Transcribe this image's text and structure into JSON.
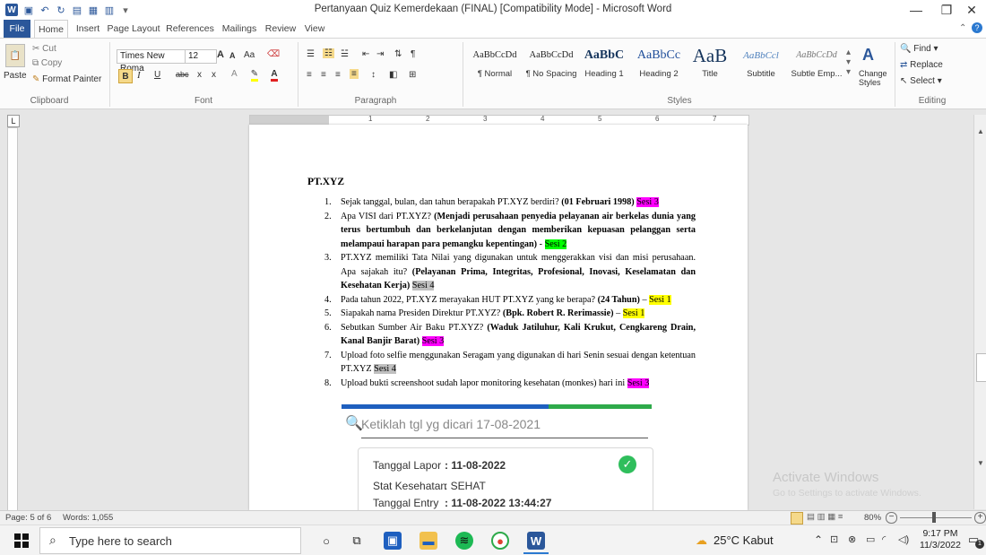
{
  "window": {
    "title": "Pertanyaan Quiz Kemerdekaan (FINAL) [Compatibility Mode] - Microsoft Word",
    "app_logo": "W",
    "minimize_glyph": "—",
    "restore_glyph": "❐",
    "close_glyph": "✕"
  },
  "tabs": [
    "File",
    "Home",
    "Insert",
    "Page Layout",
    "References",
    "Mailings",
    "Review",
    "View"
  ],
  "ribbon": {
    "clipboard": {
      "paste": "Paste",
      "cut": "Cut",
      "copy": "Copy",
      "format_painter": "Format Painter",
      "label": "Clipboard"
    },
    "font": {
      "name": "Times New Roma",
      "size": "12",
      "grow": "A",
      "shrink": "A",
      "change_case": "Aa",
      "bold": "B",
      "italic": "I",
      "underline": "U",
      "strike": "abc",
      "subscript": "x",
      "superscript": "x",
      "label": "Font"
    },
    "paragraph": {
      "label": "Paragraph",
      "pilcrow": "¶"
    },
    "styles": {
      "label": "Styles",
      "items": [
        {
          "sample": "AaBbCcDd",
          "name": "¶ Normal"
        },
        {
          "sample": "AaBbCcDd",
          "name": "¶ No Spacing"
        },
        {
          "sample": "AaBbC",
          "name": "Heading 1"
        },
        {
          "sample": "AaBbCc",
          "name": "Heading 2"
        },
        {
          "sample": "AaB",
          "name": "Title"
        },
        {
          "sample": "AaBbCcl",
          "name": "Subtitle"
        },
        {
          "sample": "AaBbCcDd",
          "name": "Subtle Emp..."
        }
      ],
      "change_styles": "Change Styles"
    },
    "editing": {
      "find": "Find",
      "replace": "Replace",
      "select": "Select",
      "label": "Editing"
    }
  },
  "ruler": {
    "numbers": [
      "1",
      "2",
      "3",
      "4",
      "5",
      "6",
      "7"
    ],
    "corner": "L"
  },
  "document": {
    "heading": "PT.XYZ",
    "questions": [
      {
        "num": "1.",
        "parts": [
          {
            "t": "Sejak tanggal, bulan, dan tahun berapakah PT.XYZ berdiri? ",
            "s": ""
          },
          {
            "t": "(01 Februari 1998)",
            "s": "b"
          },
          {
            "t": " ",
            "s": ""
          },
          {
            "t": "Sesi 3",
            "s": "hl-mag"
          }
        ]
      },
      {
        "num": "2.",
        "parts": [
          {
            "t": "Apa VISI dari PT.XYZ? ",
            "s": ""
          },
          {
            "t": "(Menjadi perusahaan penyedia pelayanan air berkelas dunia yang terus bertumbuh dan berkelanjutan dengan memberikan kepuasan pelanggan serta melampaui harapan para pemangku kepentingan)",
            "s": "b"
          },
          {
            "t": " - ",
            "s": ""
          },
          {
            "t": "Sesi 2",
            "s": "hl-grn"
          }
        ]
      },
      {
        "num": "3.",
        "parts": [
          {
            "t": "PT.XYZ memiliki Tata Nilai yang digunakan untuk menggerakkan visi dan misi perusahaan. Apa sajakah itu? ",
            "s": ""
          },
          {
            "t": "(Pelayanan Prima, Integritas, Profesional, Inovasi, Keselamatan dan Kesehatan Kerja)",
            "s": "b"
          },
          {
            "t": " ",
            "s": ""
          },
          {
            "t": "Sesi 4",
            "s": "hl-gry"
          }
        ]
      },
      {
        "num": "4.",
        "parts": [
          {
            "t": "Pada tahun 2022, PT.XYZ merayakan HUT PT.XYZ yang ke berapa? ",
            "s": ""
          },
          {
            "t": "(24 Tahun)",
            "s": "b"
          },
          {
            "t": " – ",
            "s": ""
          },
          {
            "t": "Sesi 1",
            "s": "hl-yel"
          }
        ]
      },
      {
        "num": "5.",
        "parts": [
          {
            "t": "Siapakah nama Presiden Direktur PT.XYZ? ",
            "s": ""
          },
          {
            "t": "(Bpk. Robert R. Rerimassie)",
            "s": "b"
          },
          {
            "t": " – ",
            "s": ""
          },
          {
            "t": "Sesi 1",
            "s": "hl-yel"
          }
        ]
      },
      {
        "num": "6.",
        "parts": [
          {
            "t": "Sebutkan Sumber Air Baku PT.XYZ? ",
            "s": ""
          },
          {
            "t": "(Waduk Jatiluhur, Kali Krukut, Cengkareng Drain, Kanal Banjir Barat)",
            "s": "b"
          },
          {
            "t": " ",
            "s": ""
          },
          {
            "t": "Sesi 3",
            "s": "hl-mag"
          }
        ]
      },
      {
        "num": "7.",
        "parts": [
          {
            "t": "Upload foto selfie menggunakan Seragam yang digunakan di hari Senin sesuai dengan ketentuan PT.XYZ ",
            "s": ""
          },
          {
            "t": "Sesi 4",
            "s": "hl-gry"
          }
        ]
      },
      {
        "num": "8.",
        "parts": [
          {
            "t": "Upload bukti screenshoot sudah lapor monitoring kesehatan (monkes) hari ini ",
            "s": ""
          },
          {
            "t": "Sesi 3",
            "s": "hl-mag"
          }
        ]
      }
    ],
    "embedded": {
      "search_placeholder": "Ketiklah tgl yg dicari 17-08-2021",
      "rows": [
        {
          "label": "Tanggal Lapor",
          "value": ": 11-08-2022",
          "bold": true
        },
        {
          "label": "Stat Kesehatan",
          "value": ": SEHAT",
          "bold": false
        },
        {
          "label": "Tanggal Entry",
          "value": ": 11-08-2022 13:44:27",
          "bold": true
        }
      ],
      "bar_colors": [
        "#1e5fbf",
        "#1e5fbf",
        "#2eaa4a"
      ]
    }
  },
  "watermark": {
    "title": "Activate Windows",
    "subtitle": "Go to Settings to activate Windows."
  },
  "statusbar": {
    "page": "Page: 5 of 6",
    "words": "Words: 1,055",
    "zoom": "80%"
  },
  "taskbar": {
    "search_placeholder": "Type here to search",
    "weather": "25°C  Kabut",
    "time": "9:17 PM",
    "date": "11/3/2022",
    "notification_count": "1"
  }
}
